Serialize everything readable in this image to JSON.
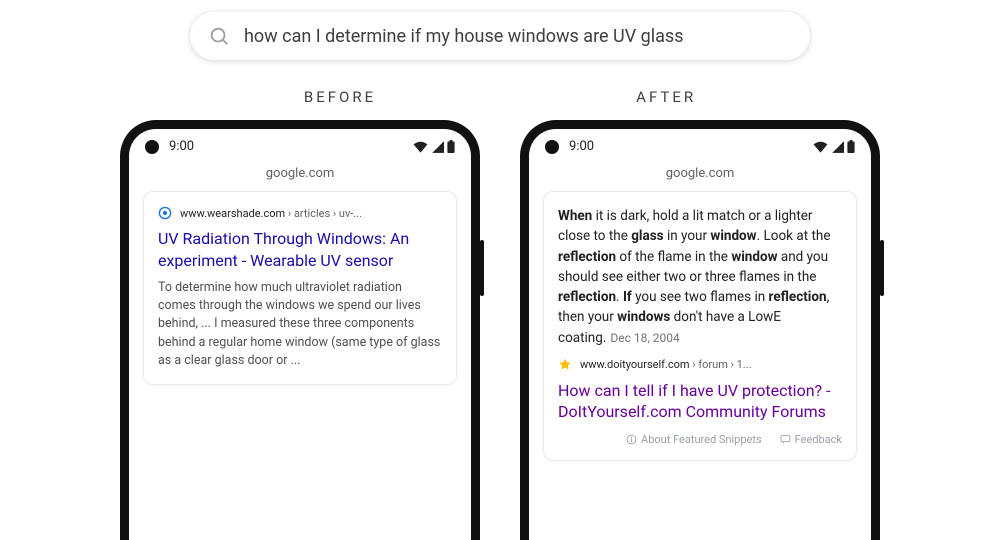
{
  "search": {
    "query": "how can I determine if my house windows are UV glass"
  },
  "labels": {
    "before": "BEFORE",
    "after": "AFTER"
  },
  "status": {
    "time": "9:00"
  },
  "url": "google.com",
  "before": {
    "domain": "www.wearshade.com",
    "path": " › articles › uv-...",
    "title": "UV Radiation Through Windows: An experiment - Wearable UV sensor",
    "desc": "To determine how much ultraviolet radiation comes through the windows we spend our lives behind, ... I measured these three components behind a regular home window (same type of glass as a clear glass door or  ..."
  },
  "after": {
    "snippet_html": "<b>When</b> it is dark, hold a lit match or a lighter close to the <b>glass</b> in your <b>window</b>. Look at the <b>reflection</b> of the flame in the <b>window</b> and you should see either two or three flames in the <b>reflection</b>. <b>If</b> you see two flames in <b>reflection</b>, then your <b>windows</b> don't have a LowE coating.",
    "date": "Dec 18, 2004",
    "domain": "www.doityourself.com",
    "path": " › forum › 1...",
    "title": "How can I tell if I have UV protection? - DoItYourself.com Community Forums",
    "footer": {
      "about": "About Featured Snippets",
      "feedback": "Feedback"
    }
  }
}
